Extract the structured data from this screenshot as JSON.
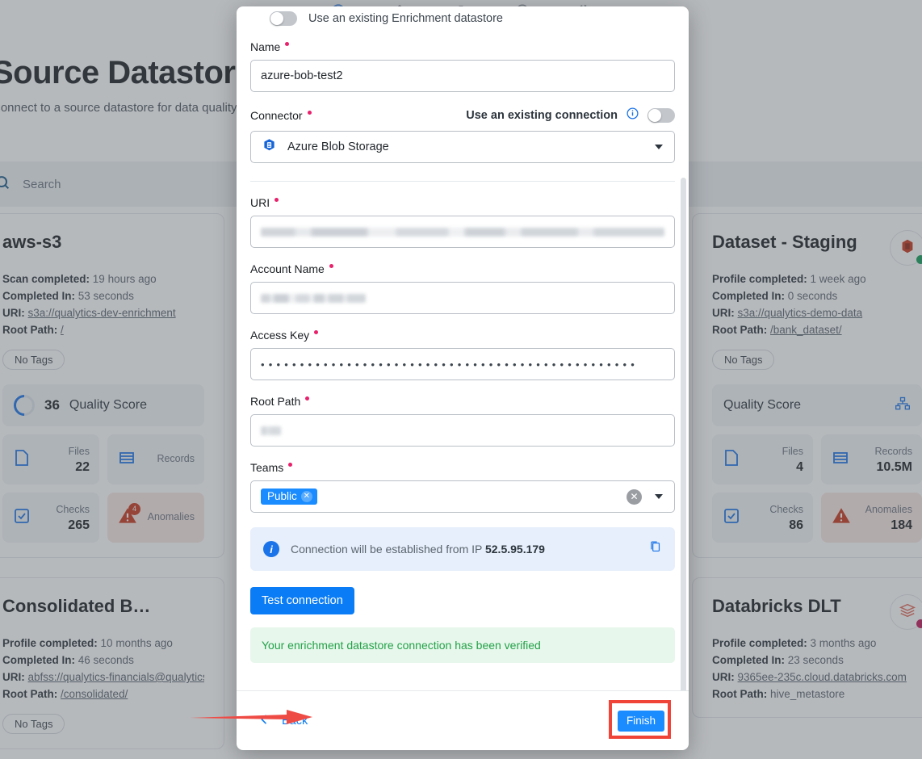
{
  "background": {
    "page_title": "Source Datastores",
    "page_subtitle": "Connect to a source datastore for data quality and observability",
    "search_placeholder": "Search",
    "cards": [
      {
        "title": "aws-s3",
        "status_label": "Scan completed:",
        "status_value": "19 hours ago",
        "duration_label": "Completed In:",
        "duration_value": "53 seconds",
        "uri_label": "URI:",
        "uri_value": "s3a://qualytics-dev-enrichment",
        "root_label": "Root Path:",
        "root_value": "/",
        "tag": "No Tags",
        "score": "36",
        "score_label": "Quality Score",
        "tiles": [
          {
            "label": "Files",
            "value": "22"
          },
          {
            "label": "Records",
            "value": ""
          },
          {
            "label": "Checks",
            "value": "265"
          },
          {
            "label": "Anomalies",
            "value": ""
          }
        ],
        "anomaly_badge": "4",
        "avatar_icon": "aws-icon",
        "status_dot": "#0f9d58"
      },
      {
        "title": "Dataset - Staging",
        "status_label": "Profile completed:",
        "status_value": "1 week ago",
        "duration_label": "Completed In:",
        "duration_value": "0 seconds",
        "uri_label": "URI:",
        "uri_value": "s3a://qualytics-demo-data",
        "root_label": "Root Path:",
        "root_value": "/bank_dataset/",
        "tag": "No Tags",
        "score": "",
        "score_label": "Quality Score",
        "tiles": [
          {
            "label": "Files",
            "value": "4"
          },
          {
            "label": "Records",
            "value": "10.5M"
          },
          {
            "label": "Checks",
            "value": "86"
          },
          {
            "label": "Anomalies",
            "value": "184"
          }
        ],
        "avatar_icon": "aws-icon",
        "status_dot": "#0f9d58"
      },
      {
        "title": "Consolidated Balance - Sta…",
        "status_label": "Profile completed:",
        "status_value": "10 months ago",
        "duration_label": "Completed In:",
        "duration_value": "46 seconds",
        "uri_label": "URI:",
        "uri_value": "abfss://qualytics-financials@qualyticsst",
        "root_label": "Root Path:",
        "root_value": "/consolidated/",
        "tag": "No Tags"
      },
      {
        "title": "Databricks DLT",
        "status_label": "Profile completed:",
        "status_value": "3 months ago",
        "duration_label": "Completed In:",
        "duration_value": "23 seconds",
        "uri_label": "URI:",
        "uri_value": "9365ee-235c.cloud.databricks.com",
        "root_label": "Root Path:",
        "root_value": "hive_metastore",
        "avatar_icon": "databricks-icon",
        "status_dot": "#c2185b"
      }
    ]
  },
  "modal": {
    "existing_enrichment_toggle_label": "Use an existing Enrichment datastore",
    "fields": {
      "name": {
        "label": "Name",
        "value": "azure-bob-test2",
        "required": true
      },
      "connector": {
        "label": "Connector",
        "required": true,
        "value": "Azure Blob Storage",
        "existing_connection_label": "Use an existing connection"
      },
      "uri": {
        "label": "URI",
        "required": true,
        "value": "",
        "redacted": true
      },
      "account_name": {
        "label": "Account Name",
        "required": true,
        "value": "",
        "redacted": true
      },
      "access_key": {
        "label": "Access Key",
        "required": true,
        "value": "••••••••••••••••••••••••••••••••••••••••••••••••"
      },
      "root_path": {
        "label": "Root Path",
        "required": true,
        "value": "",
        "redacted": true
      },
      "teams": {
        "label": "Teams",
        "required": true,
        "chips": [
          "Public"
        ]
      }
    },
    "info": {
      "text_prefix": "Connection will be established from IP ",
      "ip": "52.5.95.179"
    },
    "test_connection_label": "Test connection",
    "success_message": "Your enrichment datastore connection has been verified",
    "back_label": "Back",
    "finish_label": "Finish"
  },
  "colors": {
    "primary_blue": "#0a7cf5",
    "chip_blue": "#1a8cff",
    "required_red": "#e8216b",
    "success_green": "#24a148",
    "highlight_red": "#f04438",
    "info_bg": "#e6effb"
  }
}
